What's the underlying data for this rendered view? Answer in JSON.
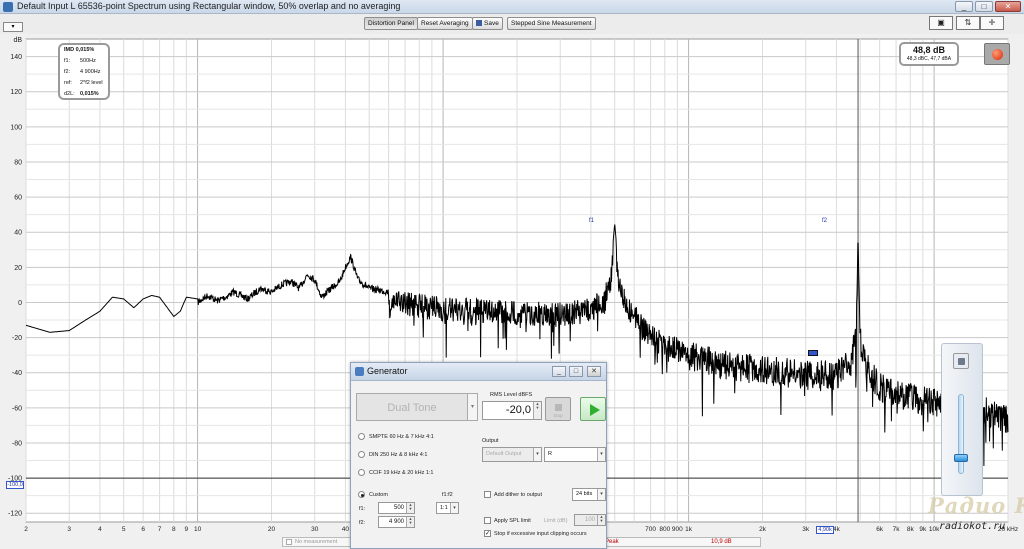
{
  "window": {
    "title": "Default Input L 65536-point Spectrum using Rectangular window, 50% overlap and no averaging",
    "controls": {
      "minimize": "_",
      "maximize": "□",
      "close": "✕"
    }
  },
  "toolbar": {
    "unit_select": "▾",
    "distortion_panel": "Distortion Panel",
    "reset_averaging": "Reset Averaging",
    "save": "Save",
    "stepped_sine": "Stepped Sine Measurement"
  },
  "view_icons": [
    "capture-icon",
    "zoom-vertical-icon",
    "expand-icon"
  ],
  "imd_panel": {
    "title": "IMD 0,015%",
    "f1_label": "f1:",
    "f1_value": "500Hz",
    "f2_label": "f2:",
    "f2_value": "4 900Hz",
    "ref_label": "ref:",
    "ref_value": "2*f2 level",
    "d2l_label": "d2L:",
    "d2l_value": "0,015%"
  },
  "level_meter": {
    "value": "48,8 dB",
    "sub": "48,3 dBC, 47,7 dBA"
  },
  "markers": {
    "f1": "f1",
    "f2": "f2",
    "cursor_freq": "4,90k",
    "ref_level": "-100,0"
  },
  "status": {
    "no_measurement": "No measurement",
    "peak_label": "Peak",
    "peak_value": "10,9 dB"
  },
  "watermark": {
    "big": "Радио КОТ",
    "small": "radiokot.ru"
  },
  "generator": {
    "title": "Generator",
    "signal_type": "Dual Tone",
    "rms_label": "RMS Level dBFS",
    "rms_value": "-20,0",
    "stop_label": "Stop",
    "options": [
      {
        "label": "SMPTE 60 Hz & 7 kHz 4:1",
        "selected": false
      },
      {
        "label": "DIN 250 Hz & 8 kHz 4:1",
        "selected": false
      },
      {
        "label": "CCIF 19 kHz & 20 kHz 1:1",
        "selected": false
      },
      {
        "label": "Custom",
        "selected": true
      }
    ],
    "output_label": "Output",
    "output_device": "Default Output",
    "output_channel": "R",
    "f1f2_label": "f1:f2",
    "f1_label": "f1:",
    "f1_value": "500",
    "f2_label": "f2:",
    "f2_value": "4 900",
    "ratio_value": "1:1",
    "dither_label": "Add dither to output",
    "dither_checked": false,
    "bits_value": "24 bits",
    "spl_label": "Apply SPL limit",
    "spl_checked": false,
    "limit_label": "Limit (dB)",
    "limit_value": "100",
    "clip_label": "Stop if excessive input clipping occurs",
    "clip_checked": true
  },
  "chart_data": {
    "type": "line",
    "title": "",
    "xlabel": "",
    "ylabel": "dB",
    "x_scale": "log",
    "xlim": [
      2,
      20000
    ],
    "ylim": [
      -125,
      150
    ],
    "grid": true,
    "y_ticks": [
      140,
      120,
      100,
      80,
      60,
      40,
      20,
      0,
      -20,
      -40,
      -60,
      -80,
      -100,
      -120
    ],
    "x_tick_labels": [
      {
        "x": 2,
        "label": "2"
      },
      {
        "x": 3,
        "label": "3"
      },
      {
        "x": 4,
        "label": "4"
      },
      {
        "x": 5,
        "label": "5"
      },
      {
        "x": 6,
        "label": "6"
      },
      {
        "x": 7,
        "label": "7"
      },
      {
        "x": 8,
        "label": "8"
      },
      {
        "x": 9,
        "label": "9"
      },
      {
        "x": 10,
        "label": "10"
      },
      {
        "x": 20,
        "label": "20"
      },
      {
        "x": 30,
        "label": "30"
      },
      {
        "x": 40,
        "label": "40"
      },
      {
        "x": 700,
        "label": "700"
      },
      {
        "x": 800,
        "label": "800"
      },
      {
        "x": 900,
        "label": "900"
      },
      {
        "x": 1000,
        "label": "1k"
      },
      {
        "x": 2000,
        "label": "2k"
      },
      {
        "x": 3000,
        "label": "3k"
      },
      {
        "x": 4000,
        "label": "4k"
      },
      {
        "x": 6000,
        "label": "6k"
      },
      {
        "x": 7000,
        "label": "7k"
      },
      {
        "x": 8000,
        "label": "8k"
      },
      {
        "x": 9000,
        "label": "9k"
      },
      {
        "x": 10000,
        "label": "10k"
      },
      {
        "x": 20000,
        "label": "20 kHz"
      }
    ],
    "series": [
      {
        "color": "#000000",
        "points": [
          [
            2,
            -13
          ],
          [
            2.5,
            -17
          ],
          [
            3,
            -16
          ],
          [
            3.5,
            -10
          ],
          [
            4,
            -5
          ],
          [
            4.5,
            3
          ],
          [
            5,
            2
          ],
          [
            5.5,
            -3
          ],
          [
            6,
            2
          ],
          [
            6.5,
            4
          ],
          [
            7,
            3
          ],
          [
            8,
            -8
          ],
          [
            8.5,
            -5
          ],
          [
            9,
            3
          ],
          [
            10,
            2
          ],
          [
            11,
            6
          ],
          [
            12,
            3
          ],
          [
            13,
            5
          ],
          [
            14,
            8
          ],
          [
            16,
            4
          ],
          [
            18,
            10
          ],
          [
            20,
            8
          ],
          [
            22,
            12
          ],
          [
            24,
            14
          ],
          [
            26,
            10
          ],
          [
            28,
            18
          ],
          [
            30,
            15
          ],
          [
            32,
            5
          ],
          [
            35,
            10
          ],
          [
            38,
            14
          ],
          [
            40,
            22
          ],
          [
            42,
            28
          ],
          [
            45,
            15
          ],
          [
            50,
            10
          ],
          [
            60,
            8
          ],
          [
            80,
            5
          ],
          [
            100,
            3
          ],
          [
            150,
            2
          ],
          [
            200,
            1
          ],
          [
            300,
            0
          ],
          [
            400,
            3
          ],
          [
            450,
            8
          ],
          [
            480,
            18
          ],
          [
            495,
            38
          ],
          [
            500,
            45
          ],
          [
            505,
            38
          ],
          [
            520,
            18
          ],
          [
            560,
            5
          ],
          [
            650,
            -8
          ],
          [
            800,
            -17
          ],
          [
            1000,
            -22
          ],
          [
            1500,
            -28
          ],
          [
            2000,
            -30
          ],
          [
            3000,
            -33
          ],
          [
            4000,
            -33
          ],
          [
            4600,
            -26
          ],
          [
            4800,
            -10
          ],
          [
            4880,
            20
          ],
          [
            4900,
            46
          ],
          [
            4920,
            20
          ],
          [
            5000,
            -12
          ],
          [
            5300,
            -28
          ],
          [
            6000,
            -40
          ],
          [
            8000,
            -46
          ],
          [
            10000,
            -49
          ],
          [
            15000,
            -52
          ],
          [
            20000,
            -58
          ]
        ],
        "noise_amplitude": 14
      }
    ],
    "annotations": [
      {
        "x": 500,
        "label": "f1"
      },
      {
        "x": 4900,
        "label": "f2"
      },
      {
        "y": -100,
        "label": "-100,0"
      }
    ]
  }
}
